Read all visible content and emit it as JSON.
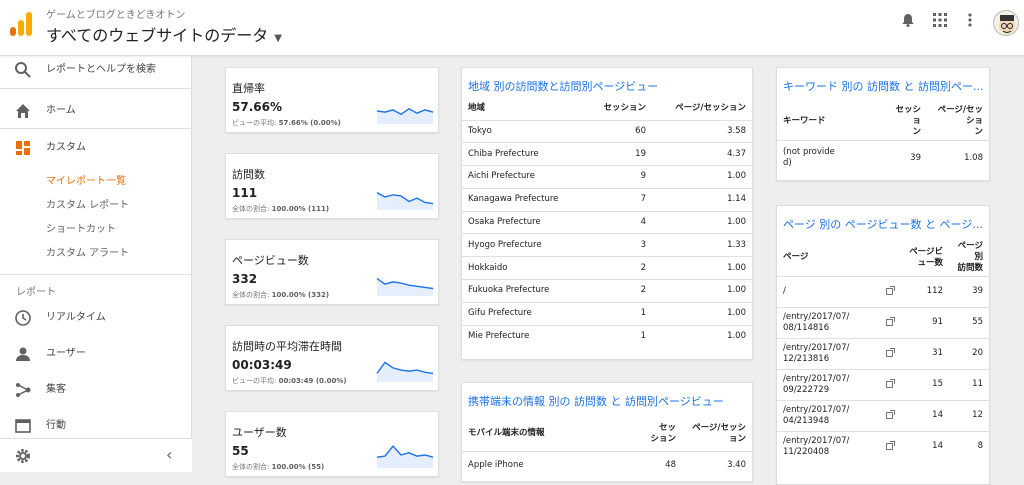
{
  "header": {
    "account": "ゲームとブログときどきオトン",
    "property": "すべてのウェブサイトのデータ"
  },
  "sidebar": {
    "search": "レポートとヘルプを検索",
    "home": "ホーム",
    "custom": "カスタム",
    "custom_sub": [
      "マイレポート一覧",
      "カスタム レポート",
      "ショートカット",
      "カスタム アラート"
    ],
    "section": "レポート",
    "reports": [
      "リアルタイム",
      "ユーザー",
      "集客",
      "行動"
    ]
  },
  "metrics": [
    {
      "title": "直帰率",
      "value": "57.66%",
      "sub_label": "ビューの平均:",
      "sub_value": "57.66% (0.00%)",
      "spark": [
        0.5,
        0.45,
        0.55,
        0.35,
        0.6,
        0.4,
        0.55,
        0.45
      ]
    },
    {
      "title": "訪問数",
      "value": "111",
      "sub_label": "全体の割合:",
      "sub_value": "100.00% (111)",
      "spark": [
        0.7,
        0.5,
        0.6,
        0.55,
        0.3,
        0.45,
        0.25,
        0.2
      ]
    },
    {
      "title": "ページビュー数",
      "value": "332",
      "sub_label": "全体の割合:",
      "sub_value": "100.00% (332)",
      "spark": [
        0.7,
        0.45,
        0.55,
        0.5,
        0.4,
        0.35,
        0.3,
        0.25
      ]
    },
    {
      "title": "訪問時の平均滞在時間",
      "value": "00:03:49",
      "sub_label": "ビューの平均:",
      "sub_value": "00:03:49 (0.00%)",
      "spark": [
        0.3,
        0.8,
        0.55,
        0.45,
        0.4,
        0.45,
        0.35,
        0.3
      ]
    },
    {
      "title": "ユーザー数",
      "value": "55",
      "sub_label": "全体の割合:",
      "sub_value": "100.00% (55)",
      "spark": [
        0.4,
        0.45,
        0.9,
        0.5,
        0.6,
        0.45,
        0.5,
        0.4
      ]
    }
  ],
  "region_table": {
    "title": "地域 別の訪問数と訪問別ページビュー",
    "headers": [
      "地域",
      "セッション",
      "ページ/セッション"
    ],
    "rows": [
      [
        "Tokyo",
        "60",
        "3.58"
      ],
      [
        "Chiba Prefecture",
        "19",
        "4.37"
      ],
      [
        "Aichi Prefecture",
        "9",
        "1.00"
      ],
      [
        "Kanagawa Prefecture",
        "7",
        "1.14"
      ],
      [
        "Osaka Prefecture",
        "4",
        "1.00"
      ],
      [
        "Hyogo Prefecture",
        "3",
        "1.33"
      ],
      [
        "Hokkaido",
        "2",
        "1.00"
      ],
      [
        "Fukuoka Prefecture",
        "2",
        "1.00"
      ],
      [
        "Gifu Prefecture",
        "1",
        "1.00"
      ],
      [
        "Mie Prefecture",
        "1",
        "1.00"
      ]
    ]
  },
  "mobile_table": {
    "title": "携帯端末の情報 別の 訪問数 と 訪問別ページビュー",
    "headers": [
      "モバイル端末の情報",
      "セッ\nション",
      "ページ/セッション"
    ],
    "rows": [
      [
        "Apple iPhone",
        "48",
        "3.40"
      ]
    ]
  },
  "keyword_table": {
    "title": "キーワード 別の 訪問数 と 訪問別ペー...",
    "headers": [
      "キーワード",
      "セッショ\nン",
      "ページ/セッショ\nン"
    ],
    "rows": [
      [
        "(not provide\nd)",
        "39",
        "1.08"
      ]
    ]
  },
  "page_table": {
    "title": "ページ 別の ページビュー数 と ページ...",
    "headers": [
      "ページ",
      "ページビ\nュー数",
      "ページ別\n訪問数"
    ],
    "rows": [
      [
        "/",
        "112",
        "39"
      ],
      [
        "/entry/2017/07/\n08/114816",
        "91",
        "55"
      ],
      [
        "/entry/2017/07/\n12/213816",
        "31",
        "20"
      ],
      [
        "/entry/2017/07/\n09/222729",
        "15",
        "11"
      ],
      [
        "/entry/2017/07/\n04/213948",
        "14",
        "12"
      ],
      [
        "/entry/2017/07/\n11/220408",
        "14",
        "8"
      ]
    ]
  },
  "colors": {
    "accent": "#e8710a",
    "link": "#1a73e8",
    "spark": "#1a73e8"
  }
}
